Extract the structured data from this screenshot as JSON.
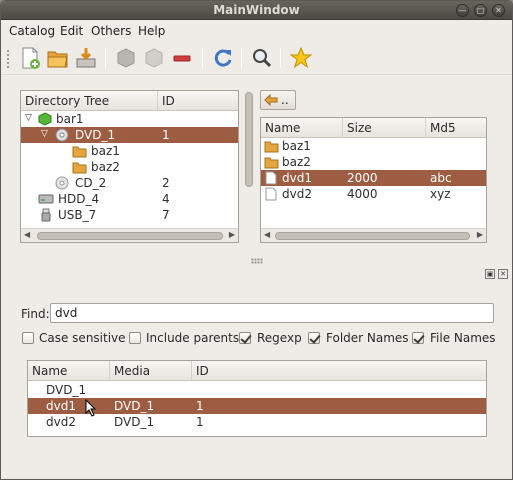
{
  "window": {
    "title": "MainWindow"
  },
  "menu": [
    "Catalog",
    "Edit",
    "Others",
    "Help"
  ],
  "toolbar": {
    "buttons": [
      "new-catalog-icon",
      "open-folder-icon",
      "save-icon",
      "add-disc-icon",
      "add-disc-disabled-icon",
      "remove-icon",
      "refresh-icon",
      "search-icon",
      "favorite-star-icon"
    ]
  },
  "tree": {
    "headers": [
      "Directory Tree",
      "ID"
    ],
    "rows": [
      {
        "name": "bar1",
        "id": "",
        "icon": "catalog-icon",
        "level": 0,
        "expander": "expanded"
      },
      {
        "name": "DVD_1",
        "id": "1",
        "icon": "disc-icon",
        "level": 1,
        "expander": "expanded",
        "selected": true
      },
      {
        "name": "baz1",
        "id": "",
        "icon": "folder-icon",
        "level": 2
      },
      {
        "name": "baz2",
        "id": "",
        "icon": "folder-icon",
        "level": 2
      },
      {
        "name": "CD_2",
        "id": "2",
        "icon": "disc-icon",
        "level": 1
      },
      {
        "name": "HDD_4",
        "id": "4",
        "icon": "hdd-icon",
        "level": 0
      },
      {
        "name": "USB_7",
        "id": "7",
        "icon": "usb-icon",
        "level": 0
      }
    ]
  },
  "files": {
    "up_button": "..",
    "headers": [
      "Name",
      "Size",
      "Md5"
    ],
    "rows": [
      {
        "name": "baz1",
        "size": "",
        "md5": "",
        "icon": "folder-icon"
      },
      {
        "name": "baz2",
        "size": "",
        "md5": "",
        "icon": "folder-icon"
      },
      {
        "name": "dvd1",
        "size": "2000",
        "md5": "abc",
        "icon": "file-icon",
        "selected": true
      },
      {
        "name": "dvd2",
        "size": "4000",
        "md5": "xyz",
        "icon": "file-icon"
      }
    ]
  },
  "find": {
    "label": "Find:",
    "value": "dvd",
    "options": [
      {
        "label": "Case sensitive",
        "checked": false
      },
      {
        "label": "Include parents",
        "checked": false
      },
      {
        "label": "Regexp",
        "checked": true
      },
      {
        "label": "Folder Names",
        "checked": true
      },
      {
        "label": "File Names",
        "checked": true
      }
    ]
  },
  "results": {
    "headers": [
      "Name",
      "Media",
      "ID"
    ],
    "rows": [
      {
        "name": "DVD_1",
        "media": "",
        "id": ""
      },
      {
        "name": "dvd1",
        "media": "DVD_1",
        "id": "1",
        "selected": true
      },
      {
        "name": "dvd2",
        "media": "DVD_1",
        "id": "1"
      }
    ]
  },
  "colors": {
    "selection": "#9c5d43",
    "titlebar": "#57544d",
    "window_bg": "#efebe7"
  }
}
